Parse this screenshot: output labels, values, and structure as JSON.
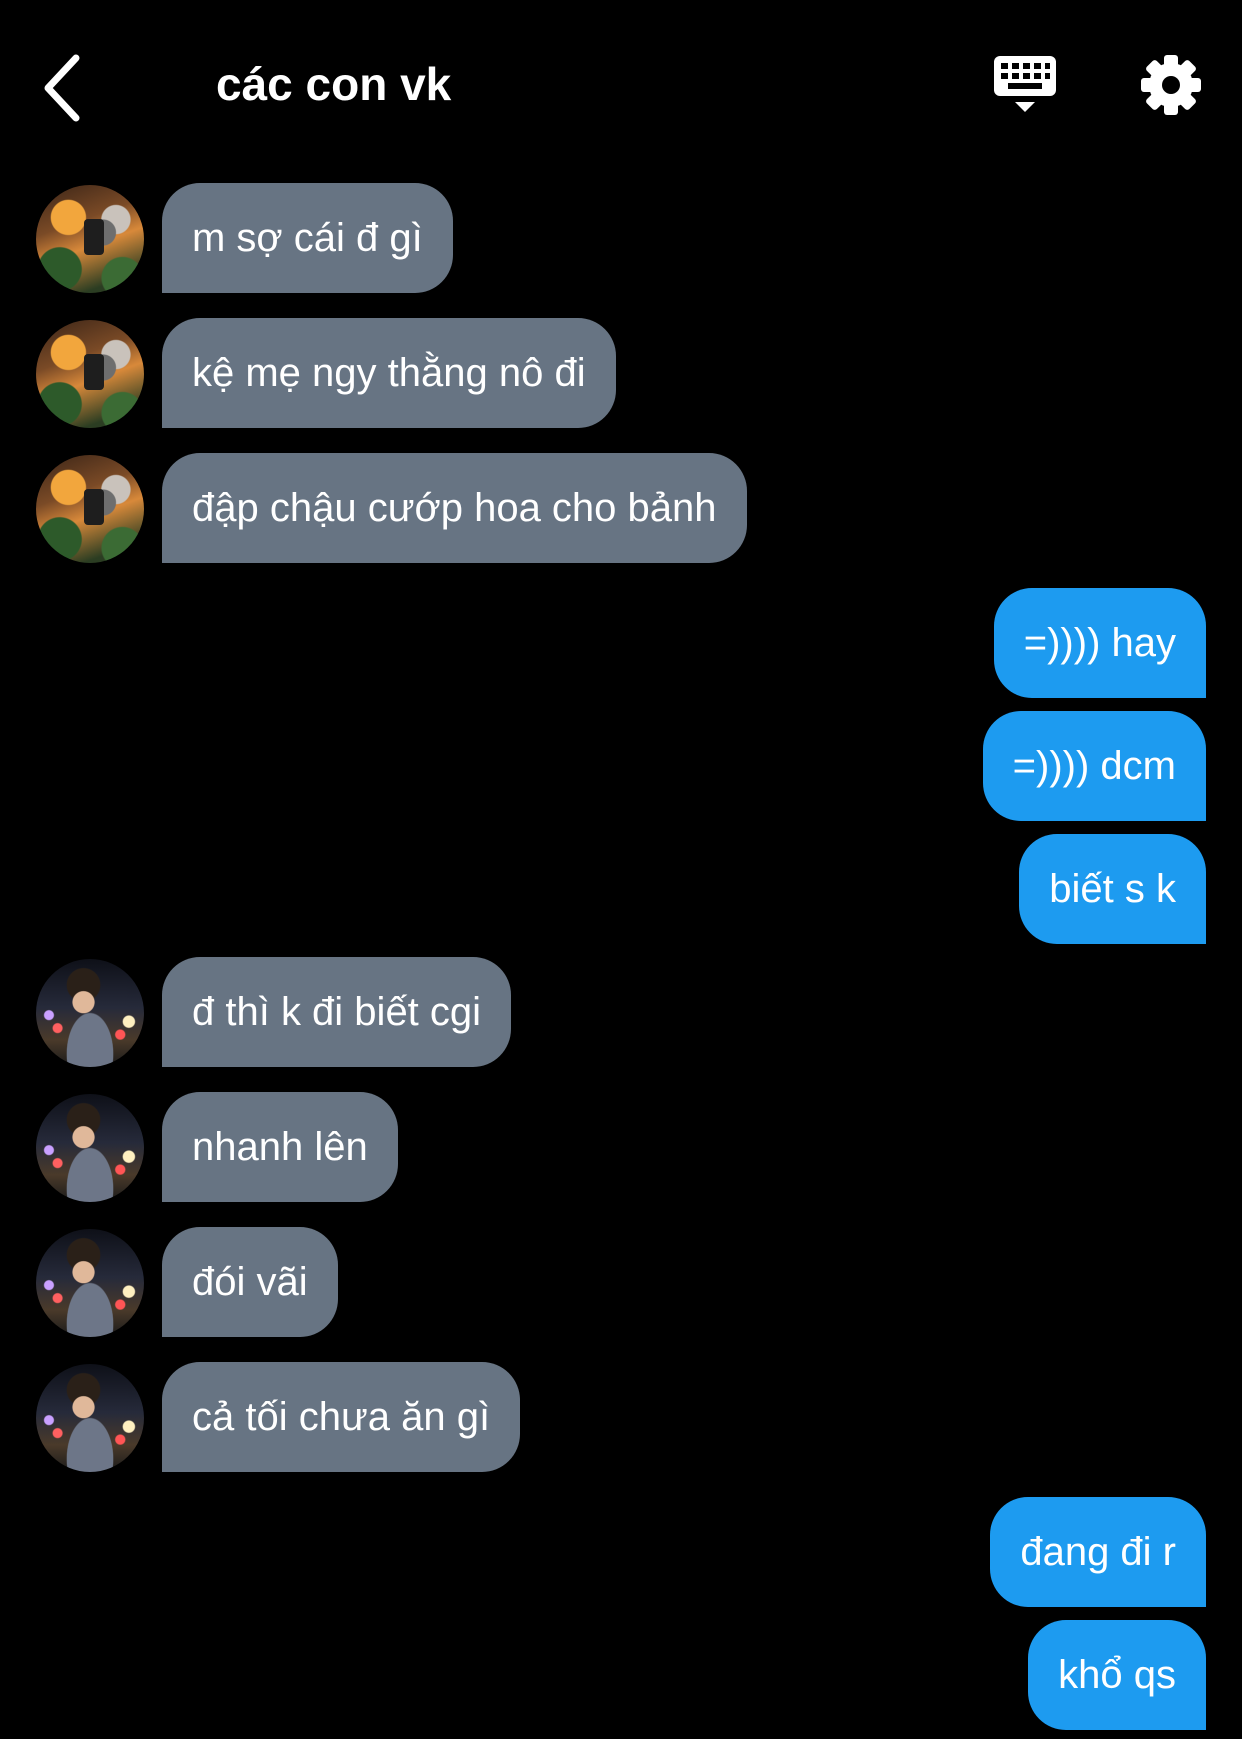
{
  "header": {
    "title": "các con vk",
    "back_icon": "chevron-left-icon",
    "keyboard_icon": "keyboard-icon",
    "settings_icon": "gear-icon"
  },
  "colors": {
    "background": "#000000",
    "incoming_bubble": "#677483",
    "outgoing_bubble": "#1d9bf0",
    "text": "#ffffff"
  },
  "messages": [
    {
      "text": "m sợ cái đ gì",
      "direction": "incoming",
      "sender": "member-a"
    },
    {
      "text": "kệ mẹ ngy thằng nô đi",
      "direction": "incoming",
      "sender": "member-a"
    },
    {
      "text": "đập chậu cướp hoa cho bảnh",
      "direction": "incoming",
      "sender": "member-a"
    },
    {
      "text": "=)))) hay",
      "direction": "outgoing"
    },
    {
      "text": "=)))) dcm",
      "direction": "outgoing"
    },
    {
      "text": "biết s k",
      "direction": "outgoing"
    },
    {
      "text": "đ thì k đi biết cgi",
      "direction": "incoming",
      "sender": "member-b"
    },
    {
      "text": "nhanh lên",
      "direction": "incoming",
      "sender": "member-b"
    },
    {
      "text": "đói vãi",
      "direction": "incoming",
      "sender": "member-b"
    },
    {
      "text": "cả tối chưa ăn gì",
      "direction": "incoming",
      "sender": "member-b"
    },
    {
      "text": "đang đi r",
      "direction": "outgoing"
    },
    {
      "text": "khổ qs",
      "direction": "outgoing"
    }
  ]
}
